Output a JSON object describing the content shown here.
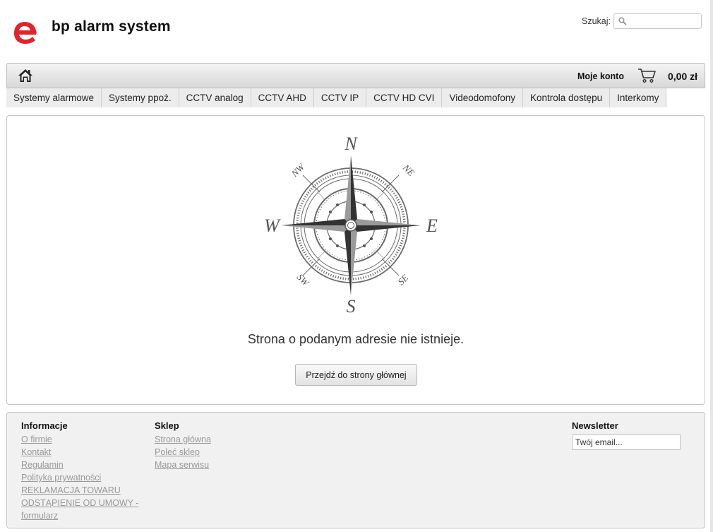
{
  "header": {
    "site_title": "bp alarm system",
    "search_label": "Szukaj:",
    "search_value": ""
  },
  "topbar": {
    "account_label": "Moje konto",
    "cart_total": "0,00 zł"
  },
  "categories": [
    "Systemy alarmowe",
    "Systemy ppoż.",
    "CCTV analog",
    "CCTV AHD",
    "CCTV IP",
    "CCTV HD CVI",
    "Videodomofony",
    "Kontrola dostępu",
    "Interkomy"
  ],
  "main": {
    "compass_labels": {
      "n": "N",
      "s": "S",
      "e": "E",
      "w": "W",
      "ne": "NE",
      "nw": "NW",
      "se": "SE",
      "sw": "SW"
    },
    "error_message": "Strona o podanym adresie nie istnieje.",
    "home_button": "Przejdź do strony głównej"
  },
  "footer": {
    "info": {
      "title": "Informacje",
      "links": [
        "O firmie",
        "Kontakt",
        "Regulamin",
        "Polityka prywatności",
        "REKLAMACJA TOWARU",
        "ODSTĄPIENIE OD UMOWY -",
        "formularz"
      ]
    },
    "shop": {
      "title": "Sklep",
      "links": [
        "Strona główna",
        "Poleć sklep",
        "Mapa serwisu"
      ]
    },
    "newsletter": {
      "title": "Newsletter",
      "placeholder": "Twój email..."
    }
  },
  "colors": {
    "logo_red": "#e3232c",
    "compass_gray": "#6a6a6a"
  }
}
